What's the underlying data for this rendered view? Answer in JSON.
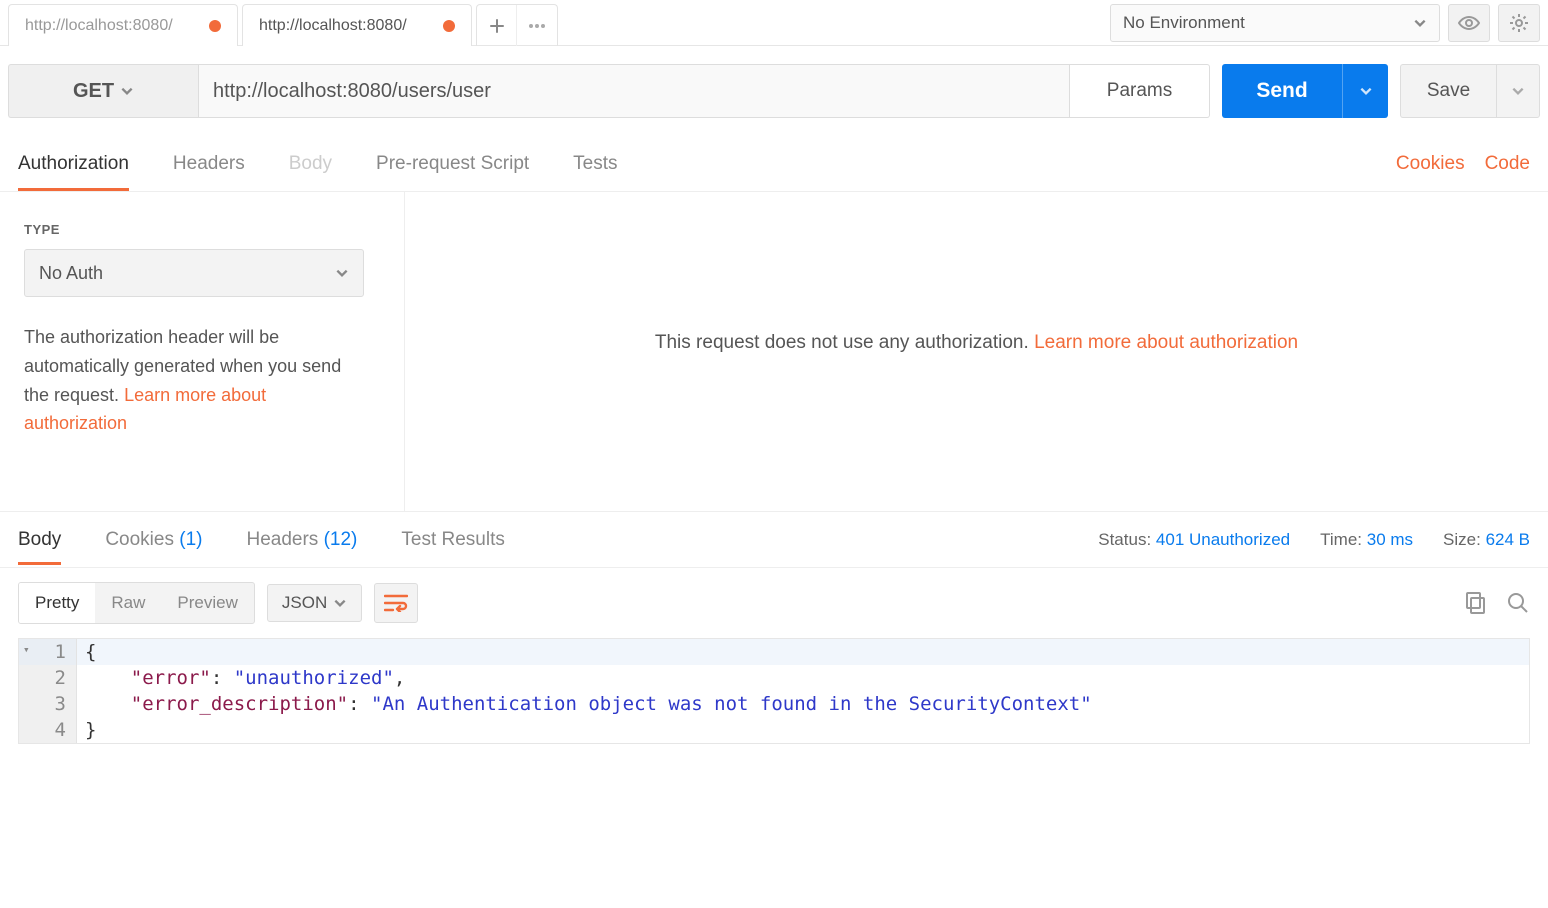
{
  "tabs": [
    {
      "label": "http://localhost:8080/",
      "unsaved": true,
      "active": false
    },
    {
      "label": "http://localhost:8080/",
      "unsaved": true,
      "active": true
    }
  ],
  "environment": {
    "selected": "No Environment"
  },
  "request": {
    "method": "GET",
    "url": "http://localhost:8080/users/user",
    "params_label": "Params",
    "send_label": "Send",
    "save_label": "Save"
  },
  "request_tabs": {
    "authorization": "Authorization",
    "headers": "Headers",
    "body": "Body",
    "prerequest": "Pre-request Script",
    "tests": "Tests"
  },
  "request_links": {
    "cookies": "Cookies",
    "code": "Code"
  },
  "auth": {
    "type_label": "TYPE",
    "selected": "No Auth",
    "desc_prefix": "The authorization header will be automatically generated when you send the request. ",
    "learn_more": "Learn more about authorization",
    "right_msg": "This request does not use any authorization. ",
    "right_link": "Learn more about authorization"
  },
  "response_tabs": {
    "body": "Body",
    "cookies_label": "Cookies",
    "cookies_count": "(1)",
    "headers_label": "Headers",
    "headers_count": "(12)",
    "tests": "Test Results"
  },
  "response_meta": {
    "status_label": "Status:",
    "status_value": "401 Unauthorized",
    "time_label": "Time:",
    "time_value": "30 ms",
    "size_label": "Size:",
    "size_value": "624 B"
  },
  "view": {
    "pretty": "Pretty",
    "raw": "Raw",
    "preview": "Preview",
    "format": "JSON"
  },
  "response_body": {
    "error": "unauthorized",
    "error_description": "An Authentication object was not found in the SecurityContext"
  },
  "gutter": {
    "l1": "1",
    "l2": "2",
    "l3": "3",
    "l4": "4"
  },
  "json_tokens": {
    "open": "{",
    "close": "}",
    "k1": "\"error\"",
    "v1": "\"unauthorized\"",
    "k2": "\"error_description\"",
    "v2": "\"An Authentication object was not found in the SecurityContext\"",
    "colon": ": ",
    "comma": ",",
    "indent": "    "
  }
}
